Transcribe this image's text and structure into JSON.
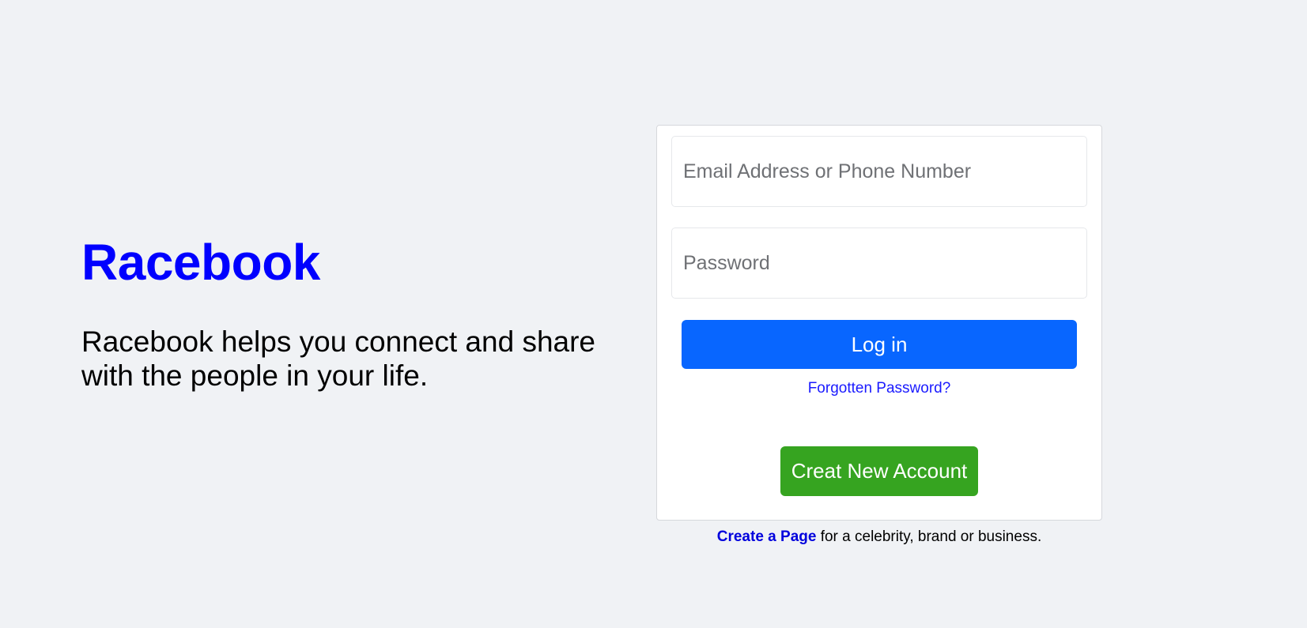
{
  "brand": {
    "logo_text": "Racebook",
    "tagline": "Racebook helps you connect and share with the people in your life.",
    "logo_color": "#0000ff"
  },
  "login_form": {
    "email_placeholder": "Email Address or Phone Number",
    "password_placeholder": "Password",
    "login_label": "Log in",
    "forgot_password_label": "Forgotten Password?",
    "create_account_label": "Creat New Account"
  },
  "footer_note": {
    "create_page_link": "Create a Page",
    "rest_text": " for a celebrity, brand or business."
  },
  "colors": {
    "page_background": "#f0f2f5",
    "primary_button": "#0866ff",
    "create_account_button": "#36a420",
    "link": "#1a1aff"
  }
}
